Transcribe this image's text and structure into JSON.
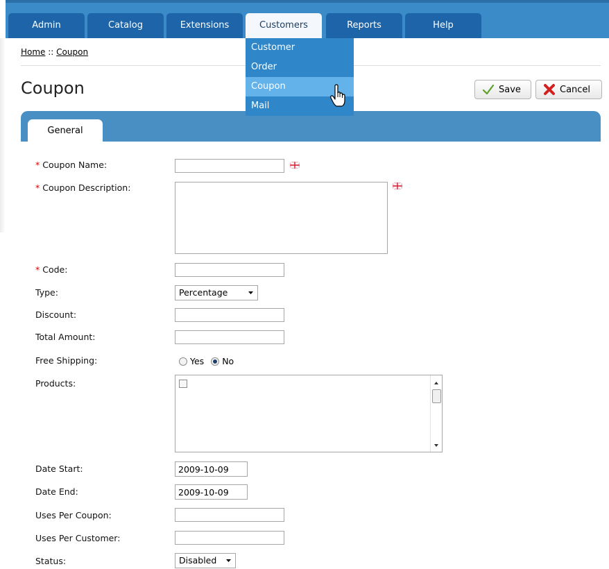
{
  "nav": {
    "tabs": [
      "Admin",
      "Catalog",
      "Extensions",
      "Customers",
      "Reports",
      "Help"
    ],
    "active": "Customers"
  },
  "dropdown": {
    "items": [
      "Customer",
      "Order",
      "Coupon",
      "Mail"
    ],
    "hovered": "Coupon"
  },
  "breadcrumb": {
    "home": "Home",
    "separator": " :: ",
    "current": "Coupon"
  },
  "page": {
    "title": "Coupon"
  },
  "buttons": {
    "save": "Save",
    "cancel": "Cancel"
  },
  "tabs": {
    "general": "General"
  },
  "form": {
    "required_mark": "*",
    "coupon_name": {
      "label": "Coupon Name:",
      "value": ""
    },
    "coupon_description": {
      "label": "Coupon Description:",
      "value": ""
    },
    "code": {
      "label": "Code:",
      "value": ""
    },
    "type": {
      "label": "Type:",
      "value": "Percentage"
    },
    "discount": {
      "label": "Discount:",
      "value": ""
    },
    "total_amount": {
      "label": "Total Amount:",
      "value": ""
    },
    "free_shipping": {
      "label": "Free Shipping:",
      "yes": "Yes",
      "no": "No",
      "selected": "No"
    },
    "products": {
      "label": "Products:"
    },
    "date_start": {
      "label": "Date Start:",
      "value": "2009-10-09"
    },
    "date_end": {
      "label": "Date End:",
      "value": "2009-10-09"
    },
    "uses_per_coupon": {
      "label": "Uses Per Coupon:",
      "value": ""
    },
    "uses_per_customer": {
      "label": "Uses Per Customer:",
      "value": ""
    },
    "status": {
      "label": "Status:",
      "value": "Disabled"
    }
  },
  "colors": {
    "nav_bar": "#3a8bc8",
    "nav_tab": "#1d65a8",
    "dropdown": "#2f86c8",
    "dropdown_hover": "#64b2ea",
    "tab_strip": "#4a8fc4",
    "required": "#dd0000"
  }
}
